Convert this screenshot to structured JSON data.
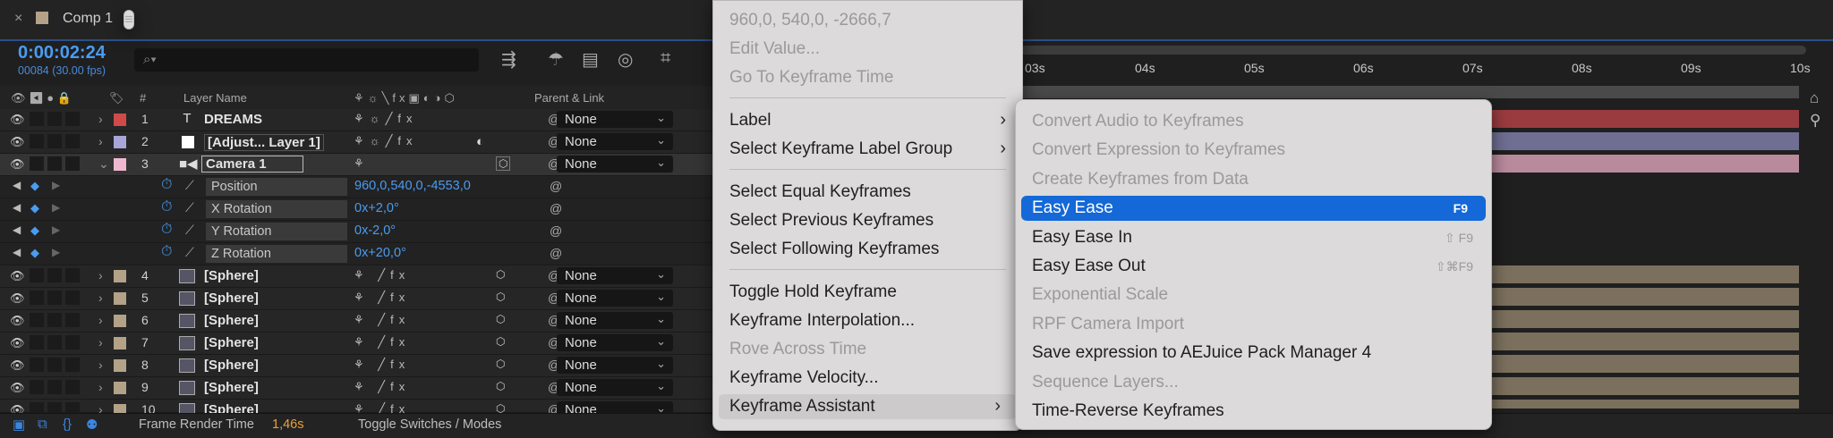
{
  "tab": {
    "close": "×",
    "name": "Comp 1",
    "menu": "≡"
  },
  "timecode": "0:00:02:24",
  "frames": "00084 (30.00 fps)",
  "search": {
    "icon": "⌕▾"
  },
  "columns": {
    "layer_name": "Layer Name",
    "parent_link": "Parent & Link",
    "num": "#"
  },
  "layers": [
    {
      "num": "1",
      "name": "DREAMS",
      "type": "T",
      "color": "#d04a4a",
      "parent": "None",
      "expanded": false
    },
    {
      "num": "2",
      "name": "[Adjust... Layer 1]",
      "type": "□",
      "color": "#a8a6d8",
      "parent": "None",
      "expanded": false
    },
    {
      "num": "3",
      "name": "Camera 1",
      "type": "camera",
      "color": "#f0b8d0",
      "parent": "None",
      "expanded": true
    }
  ],
  "properties": [
    {
      "name": "Position",
      "value": "960,0,540,0,-4553,0"
    },
    {
      "name": "X Rotation",
      "value": "0x+2,0°"
    },
    {
      "name": "Y Rotation",
      "value": "0x-2,0°"
    },
    {
      "name": "Z Rotation",
      "value": "0x+20,0°"
    }
  ],
  "spheres": [
    {
      "num": "4",
      "name": "[Sphere]",
      "parent": "None"
    },
    {
      "num": "5",
      "name": "[Sphere]",
      "parent": "None"
    },
    {
      "num": "6",
      "name": "[Sphere]",
      "parent": "None"
    },
    {
      "num": "7",
      "name": "[Sphere]",
      "parent": "None"
    },
    {
      "num": "8",
      "name": "[Sphere]",
      "parent": "None"
    },
    {
      "num": "9",
      "name": "[Sphere]",
      "parent": "None"
    },
    {
      "num": "10",
      "name": "[Sphere]",
      "parent": "None"
    }
  ],
  "sphere_color": "#b3a287",
  "bottom": {
    "frame_render_label": "Frame Render Time",
    "frame_render_value": "1,46s",
    "toggle": "Toggle Switches / Modes"
  },
  "ruler": [
    "03s",
    "04s",
    "05s",
    "06s",
    "07s",
    "08s",
    "09s",
    "10s"
  ],
  "menu1": {
    "items": [
      {
        "label": "960,0, 540,0, -2666,7",
        "disabled": true
      },
      {
        "label": "Edit Value...",
        "disabled": true
      },
      {
        "label": "Go To Keyframe Time",
        "disabled": true
      },
      {
        "label": "Label",
        "submenu": true
      },
      {
        "label": "Select Keyframe Label Group",
        "submenu": true
      },
      {
        "label": "Select Equal Keyframes"
      },
      {
        "label": "Select Previous Keyframes"
      },
      {
        "label": "Select Following Keyframes"
      },
      {
        "label": "Toggle Hold Keyframe"
      },
      {
        "label": "Keyframe Interpolation..."
      },
      {
        "label": "Rove Across Time",
        "disabled": true
      },
      {
        "label": "Keyframe Velocity..."
      },
      {
        "label": "Keyframe Assistant",
        "submenu": true,
        "highlighted": true
      }
    ]
  },
  "menu2": {
    "items": [
      {
        "label": "Convert Audio to Keyframes",
        "disabled": true
      },
      {
        "label": "Convert Expression to Keyframes",
        "disabled": true
      },
      {
        "label": "Create Keyframes from Data",
        "disabled": true
      },
      {
        "label": "Easy Ease",
        "shortcut": "F9",
        "active": true
      },
      {
        "label": "Easy Ease In",
        "shortcut": "⇧ F9"
      },
      {
        "label": "Easy Ease Out",
        "shortcut": "⇧⌘F9"
      },
      {
        "label": "Exponential Scale",
        "disabled": true
      },
      {
        "label": "RPF Camera Import",
        "disabled": true
      },
      {
        "label": "Save expression to AEJuice Pack Manager 4"
      },
      {
        "label": "Sequence Layers...",
        "disabled": true
      },
      {
        "label": "Time-Reverse Keyframes"
      }
    ]
  },
  "colors": {
    "accent": "#4a9cf0",
    "menu_active": "#1468d7",
    "menu_bg": "#dcdada"
  }
}
